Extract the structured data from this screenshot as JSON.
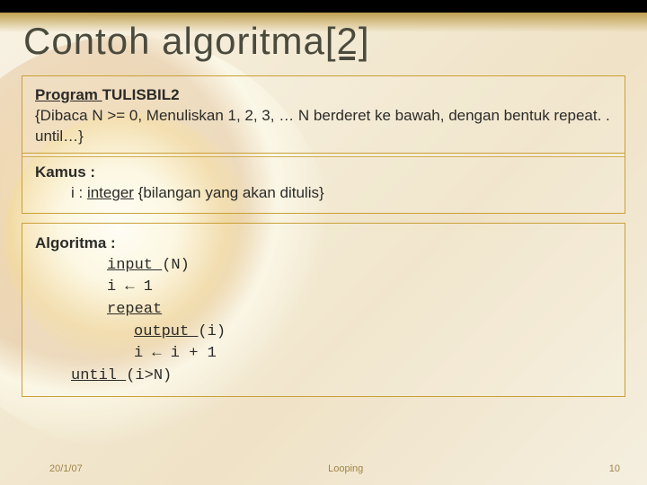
{
  "title_plain": "Contoh algoritma",
  "title_bracket": "[2]",
  "box1": {
    "l1a": "Program ",
    "l1b": "TULISBIL2",
    "l2": "{Dibaca N >= 0, Menuliskan 1, 2, 3, … N berderet ke bawah, dengan bentuk repeat. . until…}"
  },
  "box2": {
    "l1": "Kamus :",
    "l2a": "i : ",
    "l2b": "integer",
    "l2c": "  {bilangan yang akan ditulis}"
  },
  "box3": {
    "l1": "Algoritma :",
    "l2a": "input ",
    "l2b": "(N)",
    "l3": "i ← 1",
    "l4": "repeat",
    "l5a": "output ",
    "l5b": "(i)",
    "l6": "i ← i + 1",
    "l7a": "until ",
    "l7b": "(i>N)"
  },
  "footer": {
    "date": "20/1/07",
    "center": "Looping",
    "page": "10"
  }
}
